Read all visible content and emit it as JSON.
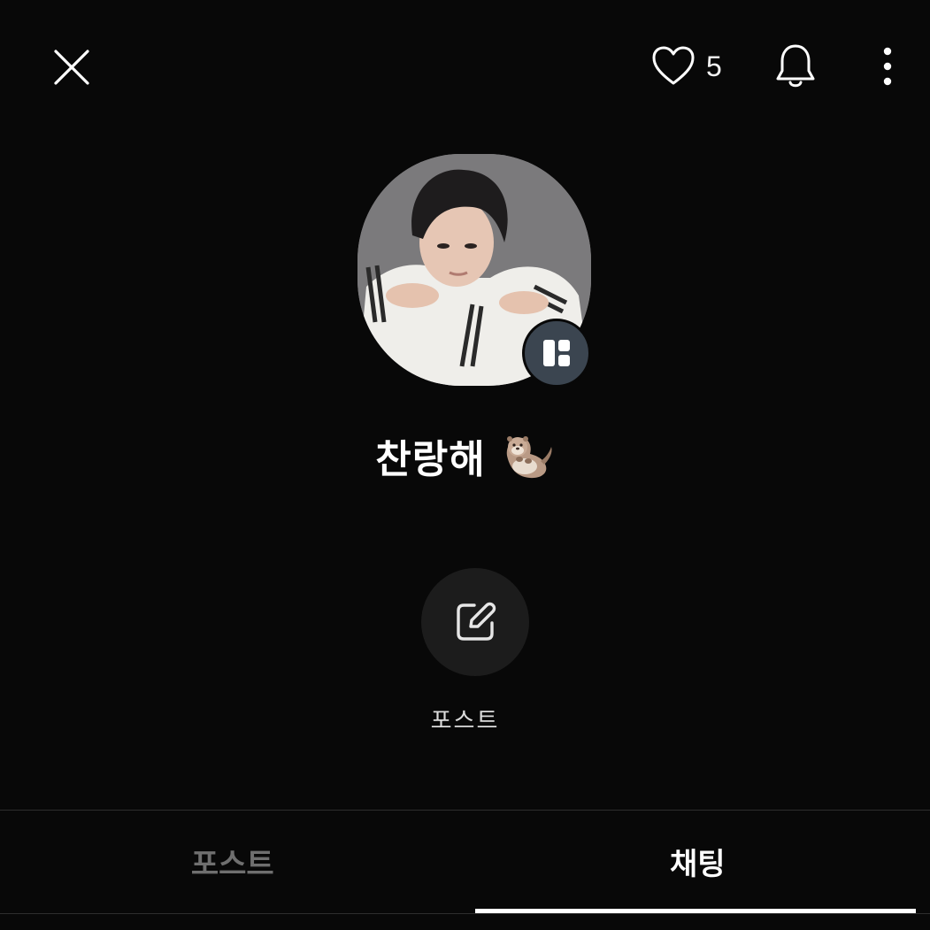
{
  "header": {
    "close_icon": "close-icon",
    "like_icon": "heart-icon",
    "like_count": "5",
    "bell_icon": "bell-icon",
    "more_icon": "more-vertical-icon"
  },
  "profile": {
    "name": "찬랑해",
    "name_emoji": "🦦",
    "badge_icon": "board-layout-icon"
  },
  "action": {
    "icon": "edit-icon",
    "label": "포스트"
  },
  "tabs": [
    {
      "label": "포스트",
      "selected": false
    },
    {
      "label": "채팅",
      "selected": true
    }
  ],
  "colors": {
    "background": "#080808",
    "badge": "#3b4550",
    "action_circle": "#1c1c1c",
    "inactive_tab": "#6f6f6f",
    "active_tab": "#ffffff"
  }
}
